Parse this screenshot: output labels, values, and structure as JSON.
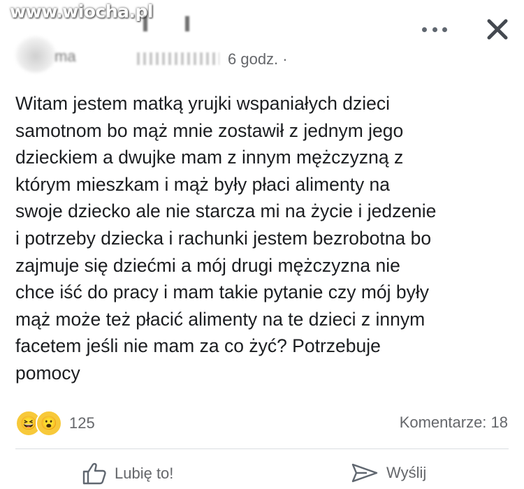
{
  "watermark": "www.wiocha.pl",
  "post": {
    "author_blurred": "ma",
    "timestamp": "6 godz. ·",
    "body": "Witam jestem matką yrujki wspaniałych dzieci\nsamotnom bo mąż mnie zostawił z jednym jego\ndzieckiem a dwujke mam z innym mężczyzną z\nktórym mieszkam i mąż były płaci alimenty na\nswoje dziecko ale nie starcza mi na życie i jedzenie\ni potrzeby dziecka i rachunki jestem bezrobotna bo\nzajmuje się dziećmi a mój drugi mężczyzna nie\nchce iść do pracy i mam takie pytanie czy mój były\nmąż może też płacić alimenty na te dzieci z innym\nfacetem jeśli nie mam za co żyć? Potrzebuje\npomocy"
  },
  "reactions": {
    "icons": [
      "haha-icon",
      "wow-icon"
    ],
    "haha_glyph": "😆",
    "wow_glyph": "😮",
    "count": "125"
  },
  "comments_label": "Komentarze: 18",
  "actions": {
    "like_label": "Lubię to!",
    "share_label": "Wyślij"
  },
  "colors": {
    "text": "#1c1e21",
    "secondary": "#65676b",
    "reaction_bg": "#f7c93a"
  }
}
